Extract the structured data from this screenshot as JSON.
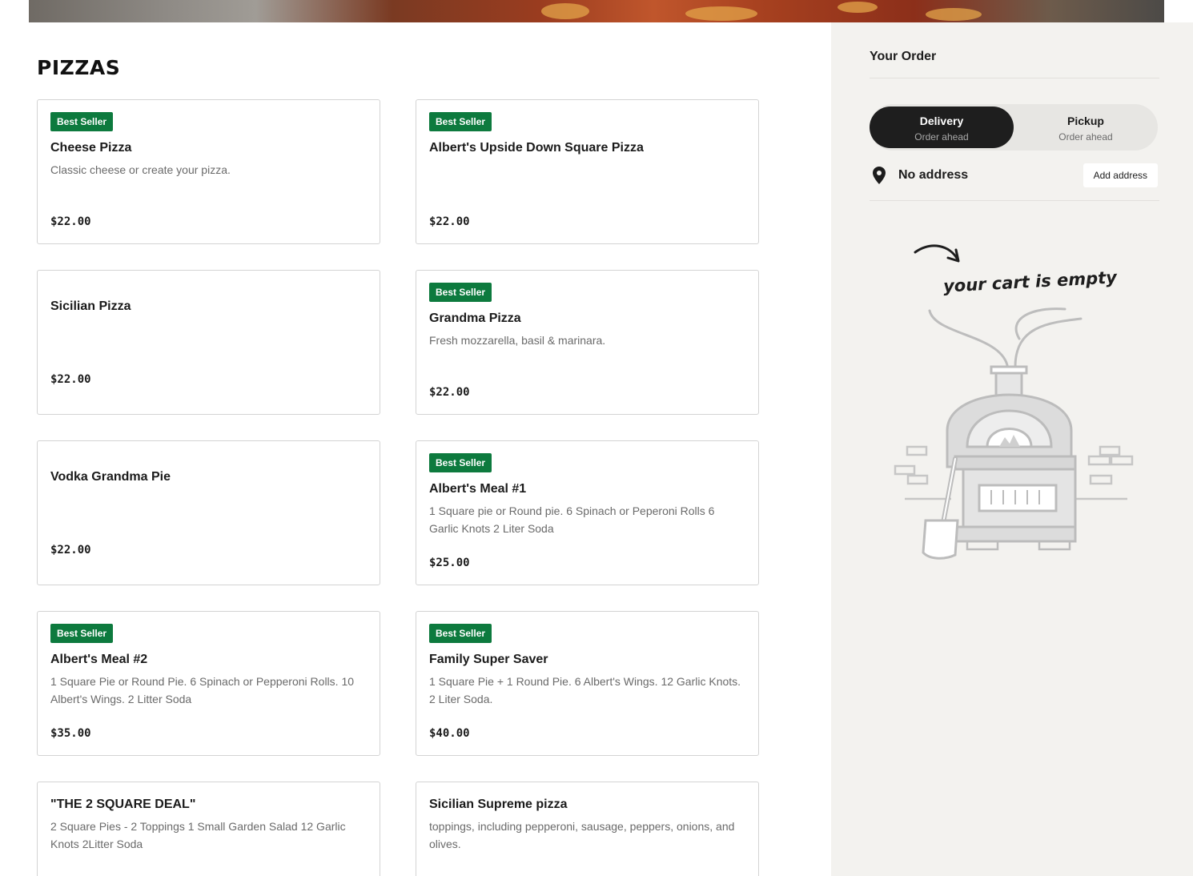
{
  "section": {
    "title": "PIZZAS"
  },
  "menu": {
    "items": [
      {
        "badge": "Best Seller",
        "name": "Cheese Pizza",
        "description": "Classic cheese or create your pizza.",
        "price": "$22.00"
      },
      {
        "badge": "Best Seller",
        "name": "Albert's Upside Down Square Pizza",
        "description": "",
        "price": "$22.00"
      },
      {
        "badge": "",
        "name": "Sicilian Pizza",
        "description": "",
        "price": "$22.00"
      },
      {
        "badge": "Best Seller",
        "name": "Grandma Pizza",
        "description": "Fresh mozzarella, basil & marinara.",
        "price": "$22.00"
      },
      {
        "badge": "",
        "name": "Vodka Grandma Pie",
        "description": "",
        "price": "$22.00"
      },
      {
        "badge": "Best Seller",
        "name": "Albert's Meal #1",
        "description": "1 Square pie or Round pie. 6 Spinach or Peperoni Rolls 6 Garlic Knots 2 Liter Soda",
        "price": "$25.00"
      },
      {
        "badge": "Best Seller",
        "name": "Albert's Meal #2",
        "description": "1 Square Pie or Round Pie. 6 Spinach or Pepperoni Rolls. 10 Albert's Wings. 2 Litter Soda",
        "price": "$35.00"
      },
      {
        "badge": "Best Seller",
        "name": "Family Super Saver",
        "description": "1 Square Pie + 1 Round Pie. 6 Albert's Wings. 12 Garlic Knots. 2 Liter Soda.",
        "price": "$40.00"
      },
      {
        "badge": "",
        "name": "\"THE 2 SQUARE DEAL\"",
        "description": "2 Square Pies - 2 Toppings 1 Small Garden Salad 12 Garlic Knots 2Litter Soda",
        "price": ""
      },
      {
        "badge": "",
        "name": "Sicilian Supreme pizza",
        "description": "toppings, including pepperoni, sausage, peppers, onions, and olives.",
        "price": ""
      }
    ]
  },
  "order": {
    "title": "Your Order",
    "delivery_label": "Delivery",
    "delivery_sub": "Order ahead",
    "pickup_label": "Pickup",
    "pickup_sub": "Order ahead",
    "address_text": "No address",
    "add_address_label": "Add address",
    "empty_text": "your cart is empty"
  },
  "colors": {
    "badge_green": "#0d7a3e",
    "sidebar_bg": "#f3f2ef",
    "toggle_active": "#1e1e1e"
  },
  "icons": {
    "address": "location-pin-icon",
    "empty_cart": "pizza-oven-illustration"
  }
}
